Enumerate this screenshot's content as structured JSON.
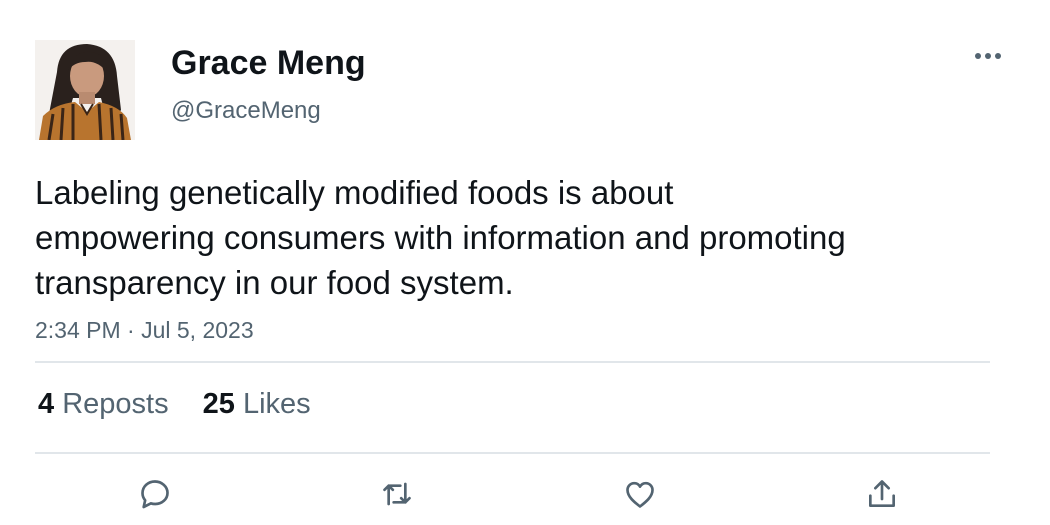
{
  "author": {
    "display_name": "Grace Meng",
    "handle": "@GraceMeng"
  },
  "tweet": {
    "text_lines": [
      "Labeling genetically modified foods is about",
      "empowering consumers with information and promoting",
      "transparency in our food system."
    ],
    "timestamp": "2:34 PM · Jul 5, 2023"
  },
  "stats": {
    "reposts_count": "4",
    "reposts_label": "Reposts",
    "likes_count": "25",
    "likes_label": "Likes"
  },
  "actions": [
    "reply-icon",
    "repost-icon",
    "like-icon",
    "share-icon"
  ],
  "colors": {
    "text": "#0f1419",
    "secondary": "#536471",
    "divider": "#e1e6ea"
  }
}
